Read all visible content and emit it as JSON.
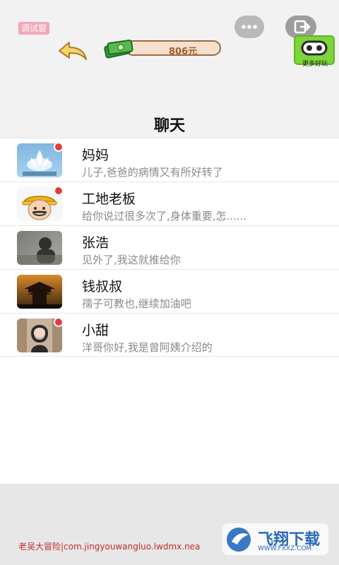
{
  "header": {
    "debug_label": "调试窗",
    "coins": "806元",
    "game_label": "更多好玩"
  },
  "page_title": "聊天",
  "chats": [
    {
      "name": "妈妈",
      "preview": "儿子,爸爸的病情又有所好转了",
      "avatar": "lotus-avatar",
      "unread": true
    },
    {
      "name": "工地老板",
      "preview": "给你说过很多次了,身体重要,怎......",
      "avatar": "worker-avatar",
      "unread": true
    },
    {
      "name": "张浩",
      "preview": "见外了,我这就推给你",
      "avatar": "man-avatar",
      "unread": false
    },
    {
      "name": "钱叔叔",
      "preview": "孺子可教也,继续加油吧",
      "avatar": "pagoda-avatar",
      "unread": false
    },
    {
      "name": "小甜",
      "preview": "洋哥你好,我是曾阿姨介绍的",
      "avatar": "girl-avatar",
      "unread": true
    }
  ],
  "footer": {
    "app_info": "老吴大冒险|com.jingyouwangluo.lwdmx.nea"
  },
  "watermark": {
    "title": "飞翔下载",
    "url": "WWW.FXXZ.COM"
  },
  "colors": {
    "accent": "#e53a3a",
    "game_button": "#7ed43b",
    "coin_text": "#a05f2d"
  }
}
